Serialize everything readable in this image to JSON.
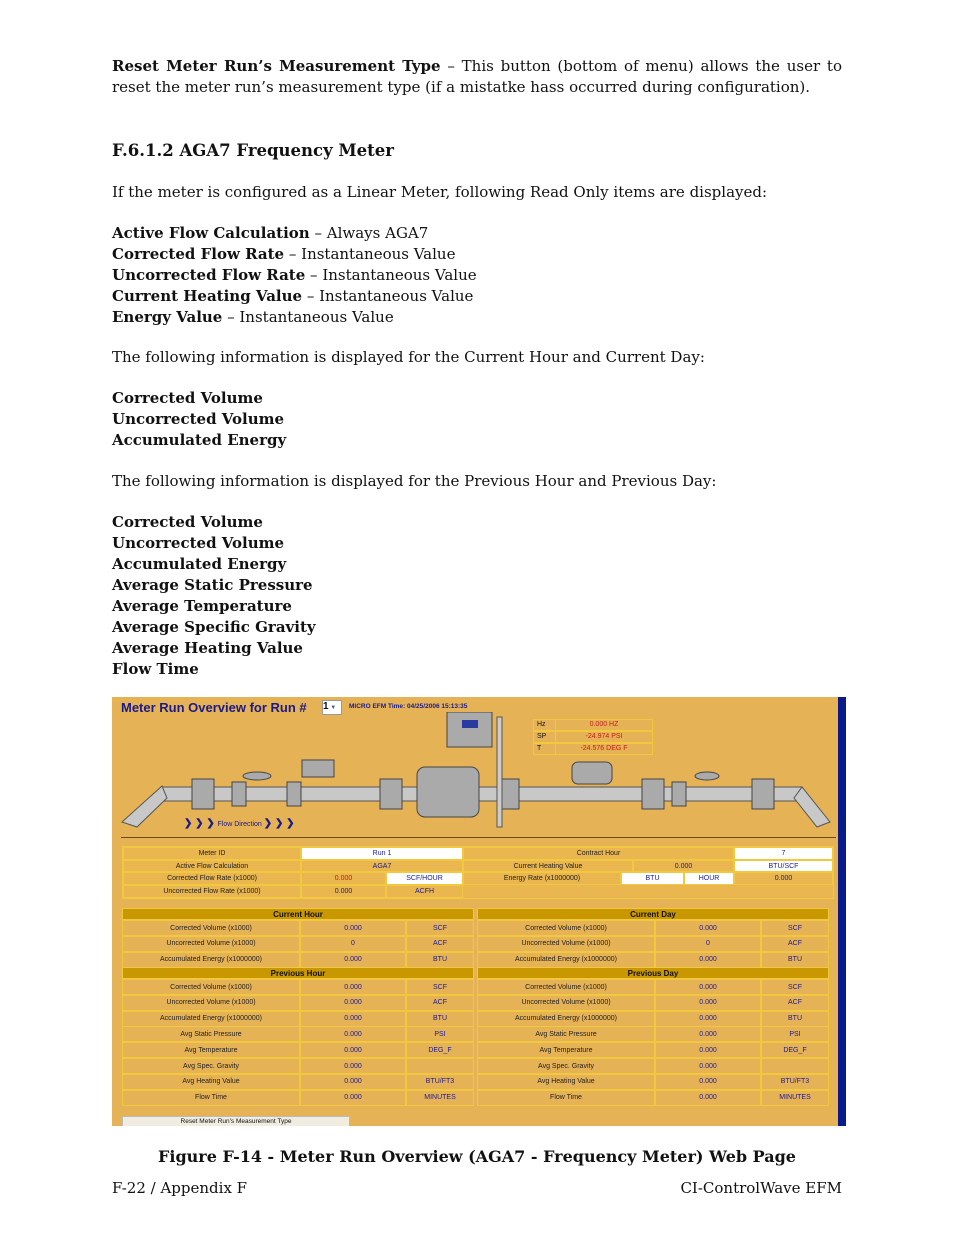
{
  "intro": {
    "term": "Reset Meter Run’s Measurement Type",
    "text": " – This button (bottom of menu) allows the user to reset the meter run’s measurement type (if a mistatke hass occurred during configuration)."
  },
  "heading": "F.6.1.2  AGA7 Frequency Meter",
  "p_linear": "If the meter is configured as a Linear Meter, following Read Only items are displayed:",
  "readonly_items": [
    {
      "term": "Active Flow Calculation",
      "desc": " – Always AGA7"
    },
    {
      "term": "Corrected Flow Rate",
      "desc": " – Instantaneous Value"
    },
    {
      "term": "Uncorrected Flow Rate",
      "desc": " – Instantaneous Value"
    },
    {
      "term": "Current Heating Value",
      "desc": " – Instantaneous Value"
    },
    {
      "term": "Energy Value",
      "desc": " – Instantaneous Value"
    }
  ],
  "p_current": "The following information is displayed for the Current Hour and Current Day:",
  "current_items": [
    "Corrected Volume",
    "Uncorrected Volume",
    "Accumulated Energy"
  ],
  "p_previous": "The following information is displayed for the Previous Hour and Previous Day:",
  "previous_items": [
    "Corrected Volume",
    "Uncorrected Volume",
    "Accumulated Energy",
    "Average Static Pressure",
    "Average Temperature",
    "Average Specific Gravity",
    "Average Heating Value",
    "Flow Time"
  ],
  "screenshot": {
    "title": "Meter Run Overview for Run #",
    "run_select": "1",
    "time_label": "MICRO EFM Time: 04/25/2006 15:13:35",
    "readings": [
      {
        "label": "Hz",
        "value": "0.000   HZ"
      },
      {
        "label": "SP",
        "value": "-24.974   PSI"
      },
      {
        "label": "T",
        "value": "-24.576   DEG F"
      }
    ],
    "flow_direction": "Flow Direction",
    "info": {
      "meter_id_label": "Meter ID",
      "meter_id": "Run 1",
      "contract_hour_label": "Contract Hour",
      "contract_hour": "7",
      "active_flow_label": "Active Flow Calculation",
      "active_flow": "AGA7",
      "heating_label": "Current Heating Value",
      "heating_value": "0.000",
      "heating_unit": "BTU/SCF",
      "corr_rate_label": "Corrected Flow Rate (x1000)",
      "corr_rate": "0.000",
      "corr_rate_unit": "SCF/HOUR",
      "energy_rate_label": "Energy Rate (x1000000)",
      "energy_unit": "BTU",
      "energy_time": "HOUR",
      "energy_rate": "0.000",
      "uncorr_rate_label": "Uncorrected Flow Rate (x1000)",
      "uncorr_rate": "0.000",
      "uncorr_rate_unit": "ACFH"
    },
    "panels": [
      {
        "title": "Current Hour",
        "rows": [
          [
            "Corrected Volume (x1000)",
            "0.000",
            "SCF"
          ],
          [
            "Uncorrected Volume (x1000)",
            "0",
            "ACF"
          ],
          [
            "Accumulated Energy (x1000000)",
            "0.000",
            "BTU"
          ]
        ]
      },
      {
        "title": "Current Day",
        "rows": [
          [
            "Corrected Volume (x1000)",
            "0.000",
            "SCF"
          ],
          [
            "Uncorrected Volume (x1000)",
            "0",
            "ACF"
          ],
          [
            "Accumulated Energy (x1000000)",
            "0.000",
            "BTU"
          ]
        ]
      },
      {
        "title": "Previous Hour",
        "rows": [
          [
            "Corrected Volume (x1000)",
            "0.000",
            "SCF"
          ],
          [
            "Uncorrected Volume (x1000)",
            "0.000",
            "ACF"
          ],
          [
            "Accumulated Energy (x1000000)",
            "0.000",
            "BTU"
          ],
          [
            "Avg Static Pressure",
            "0.000",
            "PSI"
          ],
          [
            "Avg Temperature",
            "0.000",
            "DEG_F"
          ],
          [
            "Avg Spec. Gravity",
            "0.000",
            ""
          ],
          [
            "Avg Heating Value",
            "0.000",
            "BTU/FT3"
          ],
          [
            "Flow Time",
            "0.000",
            "MINUTES"
          ]
        ]
      },
      {
        "title": "Previous Day",
        "rows": [
          [
            "Corrected Volume (x1000)",
            "0.000",
            "SCF"
          ],
          [
            "Uncorrected Volume (x1000)",
            "0.000",
            "ACF"
          ],
          [
            "Accumulated Energy (x1000000)",
            "0.000",
            "BTU"
          ],
          [
            "Avg Static Pressure",
            "0.000",
            "PSI"
          ],
          [
            "Avg Temperature",
            "0.000",
            "DEG_F"
          ],
          [
            "Avg Spec. Gravity",
            "0.000",
            ""
          ],
          [
            "Avg Heating Value",
            "0.000",
            "BTU/FT3"
          ],
          [
            "Flow Time",
            "0.000",
            "MINUTES"
          ]
        ]
      }
    ],
    "reset_button": "Reset Meter Run's Measurement Type",
    "colors": {
      "background": "#e6b256",
      "header": "#c99700",
      "title": "#1a1a8a",
      "reading": "#c0201a"
    }
  },
  "caption": "Figure F-14 - Meter Run Overview (AGA7 - Frequency Meter) Web Page",
  "footer": {
    "left": "F-22 / Appendix F",
    "right": "CI-ControlWave EFM"
  }
}
